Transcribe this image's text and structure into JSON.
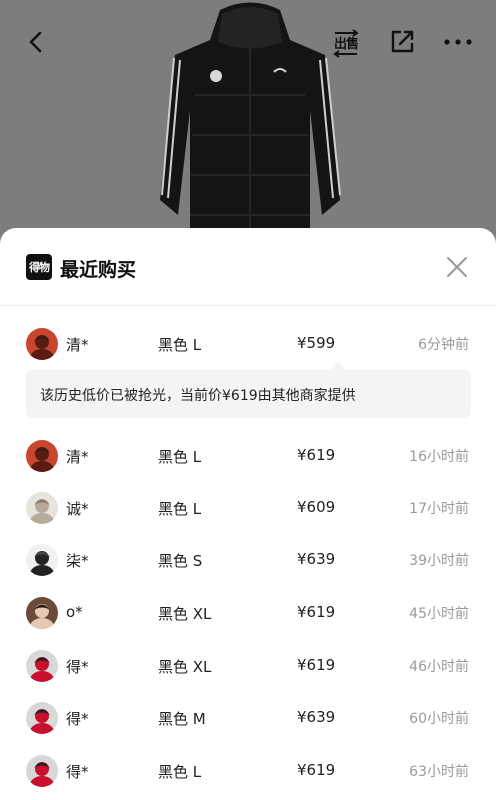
{
  "header": {
    "sell_label": "出售"
  },
  "sheet": {
    "logo_text": "得物",
    "title": "最近购买"
  },
  "notice": "该历史低价已被抢光，当前价¥619由其他商家提供",
  "purchases": [
    {
      "buyer": "清*",
      "sku": "黑色 L",
      "price": "¥599",
      "time": "6分钟前"
    },
    {
      "buyer": "清*",
      "sku": "黑色 L",
      "price": "¥619",
      "time": "16小时前"
    },
    {
      "buyer": "诚*",
      "sku": "黑色 L",
      "price": "¥609",
      "time": "17小时前"
    },
    {
      "buyer": "柒*",
      "sku": "黑色 S",
      "price": "¥639",
      "time": "39小时前"
    },
    {
      "buyer": "o*",
      "sku": "黑色 XL",
      "price": "¥619",
      "time": "45小时前"
    },
    {
      "buyer": "得*",
      "sku": "黑色 XL",
      "price": "¥619",
      "time": "46小时前"
    },
    {
      "buyer": "得*",
      "sku": "黑色 M",
      "price": "¥639",
      "time": "60小时前"
    },
    {
      "buyer": "得*",
      "sku": "黑色 L",
      "price": "¥619",
      "time": "63小时前"
    }
  ],
  "icons": {
    "back": "chevron-left-icon",
    "sell": "sell-icon",
    "share": "share-icon",
    "more": "more-icon",
    "close": "close-icon"
  }
}
